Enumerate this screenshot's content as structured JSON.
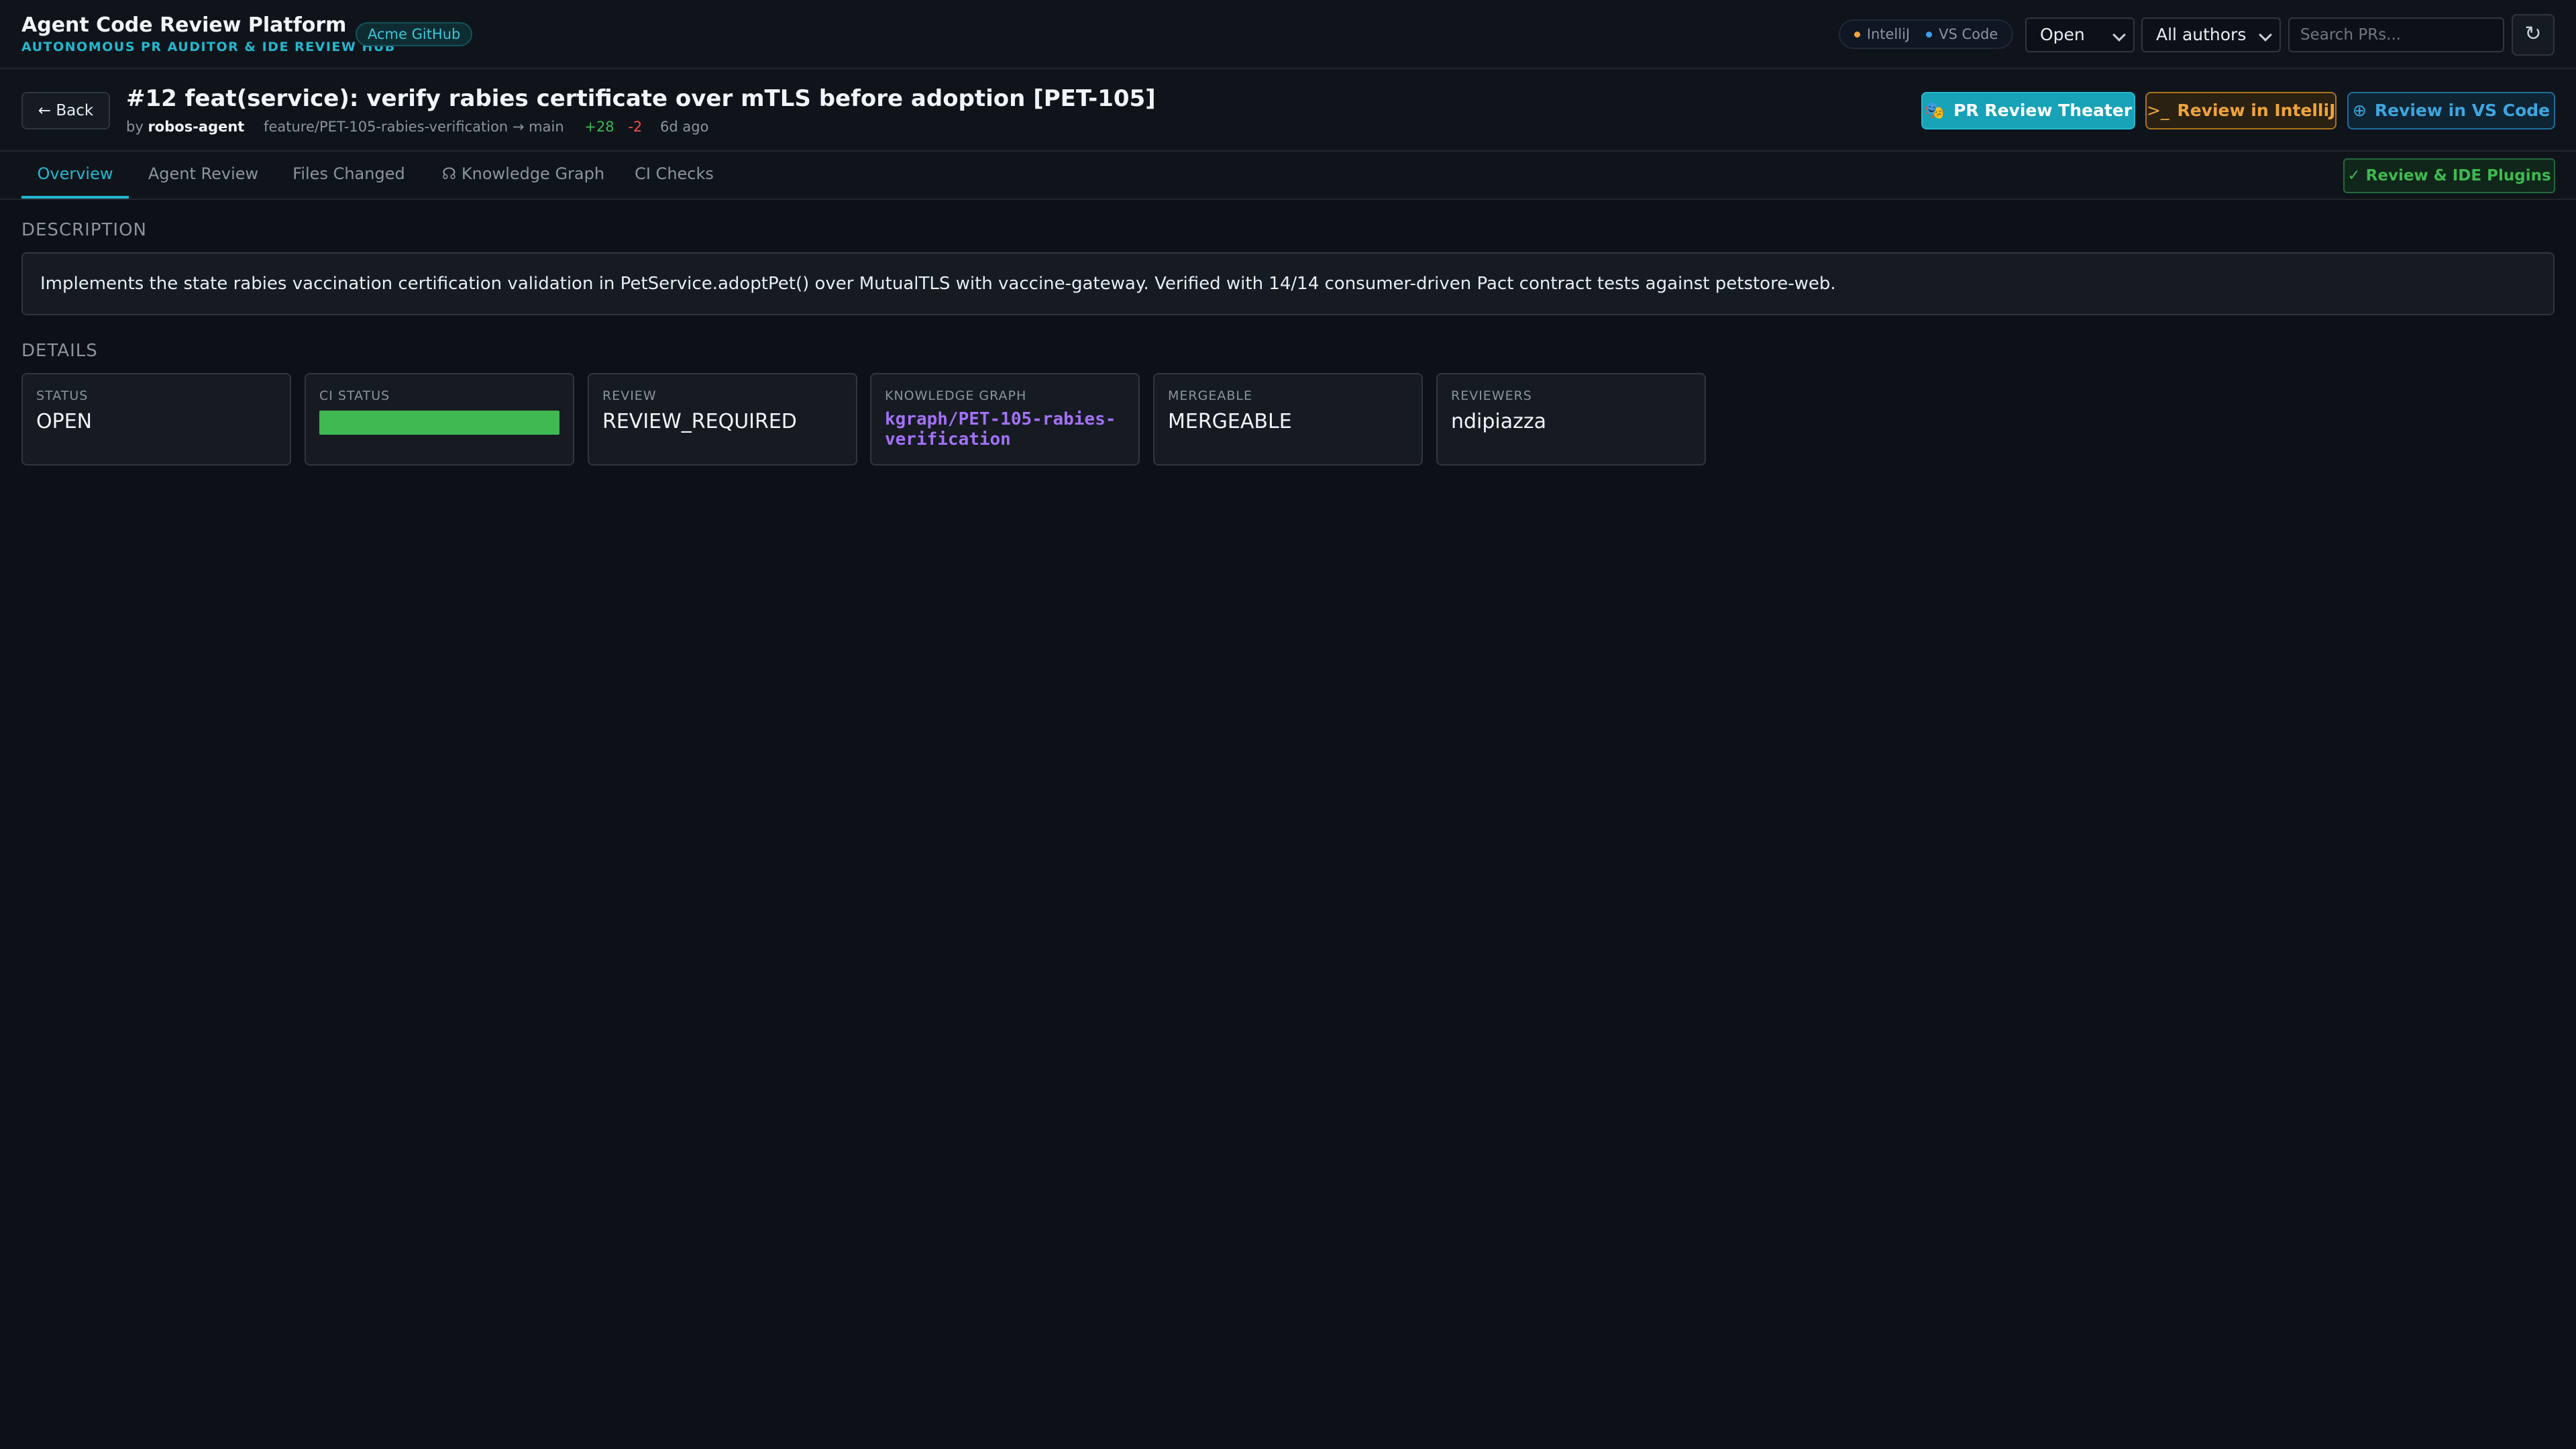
{
  "app": {
    "title": "Agent Code Review Platform",
    "subtitle": "AUTONOMOUS PR AUDITOR & IDE REVIEW HUB",
    "org_badge": "Acme GitHub"
  },
  "header": {
    "ide_status": {
      "intellij": "IntelliJ",
      "vscode": "VS Code"
    },
    "status_filter": "Open",
    "author_filter": "All authors",
    "search_placeholder": "Search PRs...",
    "refresh_glyph": "↻"
  },
  "pr": {
    "back_label": "← Back",
    "title": "#12 feat(service): verify rabies certificate over mTLS before adoption [PET-105]",
    "by_prefix": "by",
    "author": "robos-agent",
    "branch": "feature/PET-105-rabies-verification → main",
    "additions": "+28",
    "deletions": "-2",
    "age": "6d ago",
    "actions": {
      "theater": {
        "icon": "🎭",
        "label": "PR Review Theater"
      },
      "intellij": {
        "icon": ">_",
        "label": "Review in IntelliJ"
      },
      "vscode": {
        "icon": "⊕",
        "label": "Review in VS Code"
      }
    }
  },
  "tabs": [
    {
      "label": "Overview",
      "active": true
    },
    {
      "label": "Agent Review"
    },
    {
      "label": "Files Changed"
    },
    {
      "icon": "☊",
      "label": "Knowledge Graph"
    },
    {
      "label": "CI Checks"
    }
  ],
  "plugins_button": {
    "icon": "✓",
    "label": "Review & IDE Plugins"
  },
  "description": {
    "heading": "DESCRIPTION",
    "text": "Implements the state rabies vaccination certification validation in PetService.adoptPet() over MutualTLS with vaccine-gateway. Verified with 14/14 consumer-driven Pact contract tests against petstore-web."
  },
  "details": {
    "heading": "DETAILS",
    "status": {
      "label": "STATUS",
      "value": "OPEN"
    },
    "ci_status": {
      "label": "CI STATUS",
      "bar_fill": 1.0,
      "color": "#3fb950"
    },
    "review": {
      "label": "REVIEW",
      "value": "REVIEW_REQUIRED"
    },
    "knowledge_graph": {
      "label": "KNOWLEDGE GRAPH",
      "value": "kgraph/PET-105-rabies-verification"
    },
    "mergeable": {
      "label": "MERGEABLE",
      "value": "MERGEABLE"
    },
    "reviewers": {
      "label": "REVIEWERS",
      "value": "ndipiazza"
    }
  },
  "colors": {
    "accent": "#22b8cf",
    "background": "#0d1117",
    "success": "#3fb950",
    "danger": "#f85149",
    "intellij": "#f0a43a",
    "vscode": "#3ea6e0",
    "graph": "#a371f7"
  }
}
